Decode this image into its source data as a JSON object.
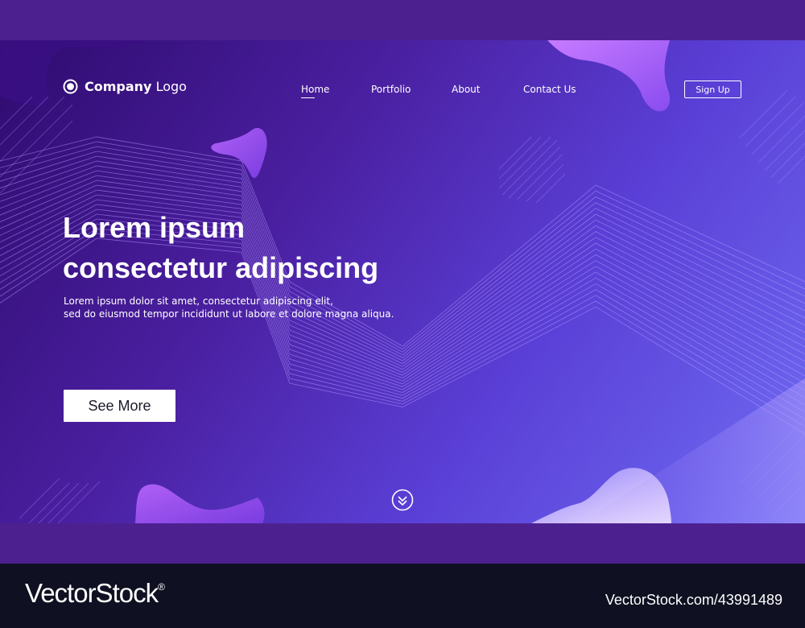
{
  "logo": {
    "strong": "Company",
    "light": "Logo"
  },
  "nav": {
    "items": [
      {
        "label": "Home",
        "active": true
      },
      {
        "label": "Portfolio"
      },
      {
        "label": "About"
      },
      {
        "label": "Contact Us"
      }
    ],
    "signup_label": "Sign Up"
  },
  "hero": {
    "headline_line1": "Lorem ipsum",
    "headline_line2": "consectetur adipiscing",
    "sub_line1": "Lorem ipsum dolor sit amet, consectetur adipiscing elit,",
    "sub_line2": "sed do eiusmod tempor incididunt ut labore et dolore magna aliqua.",
    "cta_label": "See More"
  },
  "watermark": {
    "brand": "VectorStock",
    "registered": "®",
    "stock_id": "VectorStock.com/43991489"
  },
  "colors": {
    "frame": "#4c218f",
    "hero_start": "#2f0b6e",
    "hero_end": "#6f6cf3",
    "footer": "#0f1021",
    "text": "#ffffff"
  },
  "icons": {
    "logo": "target-circle-icon",
    "scroll": "double-chevron-down-icon"
  }
}
